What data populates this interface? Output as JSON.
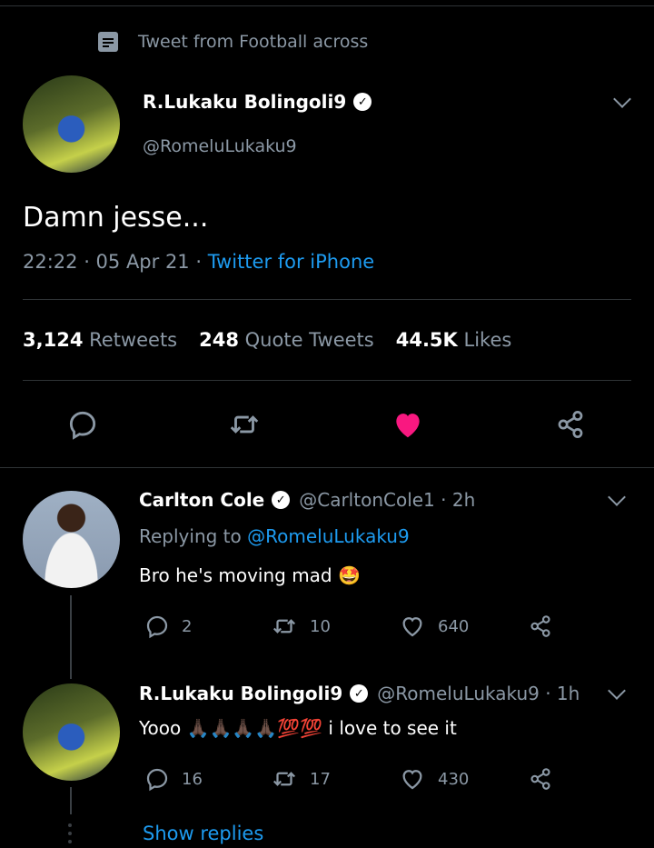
{
  "context": {
    "text": "Tweet from Football across",
    "icon": "list-icon"
  },
  "main_tweet": {
    "author_name": "R.Lukaku Bolingoli9",
    "handle": "@RomeluLukaku9",
    "text": "Damn jesse...",
    "time": "22:22 · 05 Apr 21 · ",
    "source": "Twitter for iPhone",
    "stats": {
      "retweets_count": "3,124",
      "retweets_label": "Retweets",
      "quotes_count": "248",
      "quotes_label": "Quote Tweets",
      "likes_count": "44.5K",
      "likes_label": "Likes"
    },
    "liked": true,
    "like_color": "#f91880"
  },
  "replies": [
    {
      "author_name": "Carlton Cole",
      "handle_time": "@CarltonCole1 · 2h",
      "replying_prefix": "Replying to ",
      "replying_to": "@RomeluLukaku9",
      "text": "Bro he's moving mad 🤩",
      "replies_count": "2",
      "retweets_count": "10",
      "likes_count": "640"
    },
    {
      "author_name": "R.Lukaku Bolingoli9",
      "handle_time": "@RomeluLukaku9 · 1h",
      "text": "Yooo 🙏🏿🙏🏿🙏🏿🙏🏿💯💯 i love to see it",
      "replies_count": "16",
      "retweets_count": "17",
      "likes_count": "430"
    }
  ],
  "show_replies": "Show replies",
  "colors": {
    "background": "#000000",
    "accent": "#1d9bf0",
    "muted": "#8b98a5",
    "like": "#f91880"
  }
}
